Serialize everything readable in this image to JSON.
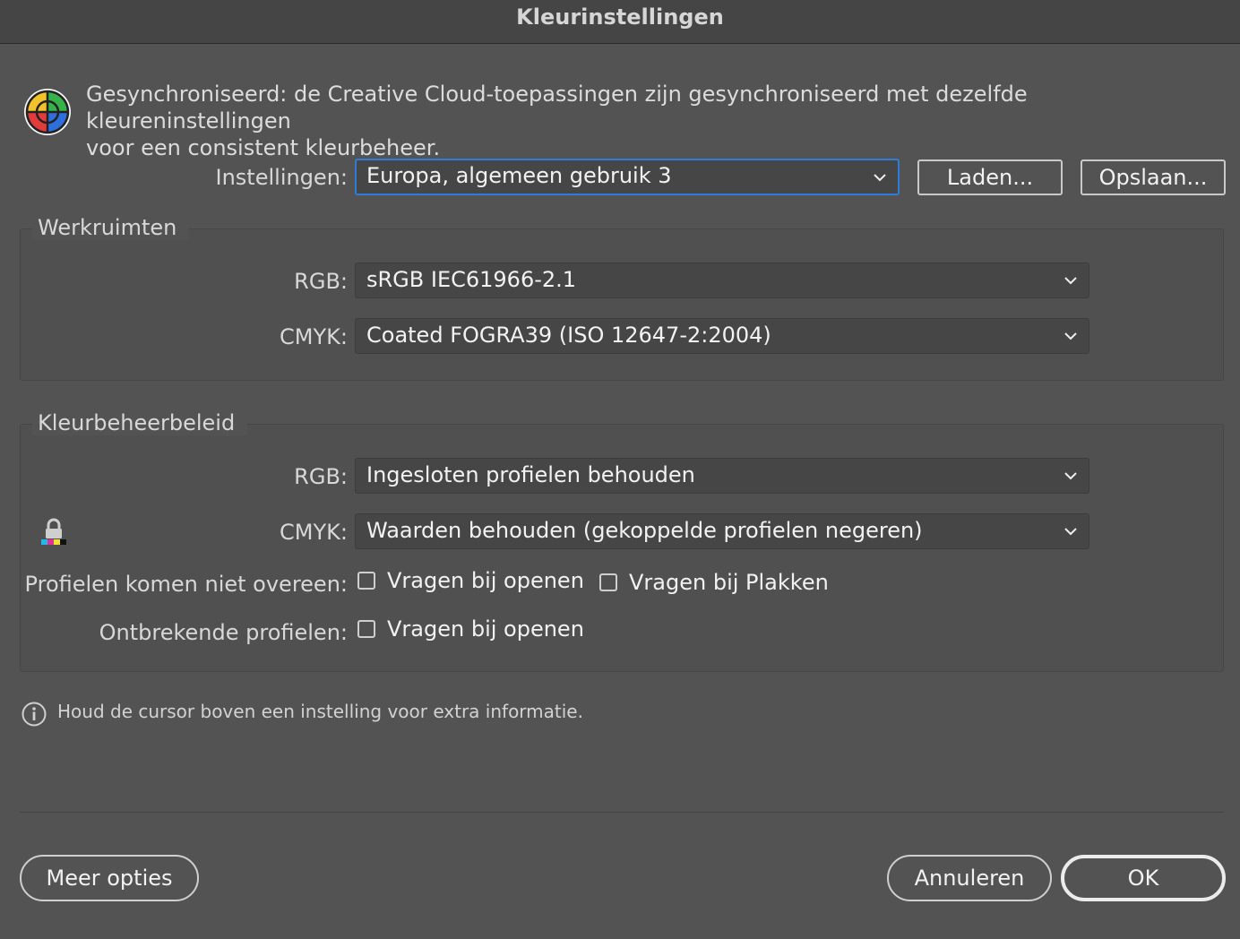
{
  "window": {
    "title": "Kleurinstellingen"
  },
  "sync": {
    "icon": "color-wheel-icon",
    "text": "Gesynchroniseerd: de Creative Cloud-toepassingen zijn gesynchroniseerd met dezelfde kleureninstellingen\nvoor een consistent kleurbeheer."
  },
  "settings": {
    "label": "Instellingen:",
    "value": "Europa, algemeen gebruik 3",
    "load_label": "Laden...",
    "save_label": "Opslaan..."
  },
  "workspaces": {
    "title": "Werkruimten",
    "rgb_label": "RGB:",
    "rgb_value": "sRGB IEC61966-2.1",
    "cmyk_label": "CMYK:",
    "cmyk_value": "Coated FOGRA39 (ISO 12647-2:2004)"
  },
  "policies": {
    "title": "Kleurbeheerbeleid",
    "rgb_label": "RGB:",
    "rgb_value": "Ingesloten profielen behouden",
    "cmyk_label": "CMYK:",
    "cmyk_value": "Waarden behouden (gekoppelde profielen negeren)",
    "mismatch_label": "Profielen komen niet overeen:",
    "mismatch_open": {
      "label": "Vragen bij openen",
      "checked": false
    },
    "mismatch_paste": {
      "label": "Vragen bij Plakken",
      "checked": false
    },
    "missing_label": "Ontbrekende profielen:",
    "missing_open": {
      "label": "Vragen bij openen",
      "checked": false
    }
  },
  "info": {
    "icon": "info-icon",
    "text": "Houd de cursor boven een instelling voor extra informatie."
  },
  "footer": {
    "more_options": "Meer opties",
    "cancel": "Annuleren",
    "ok": "OK"
  },
  "colors": {
    "background": "#535353",
    "focus": "#2f7dd8"
  }
}
